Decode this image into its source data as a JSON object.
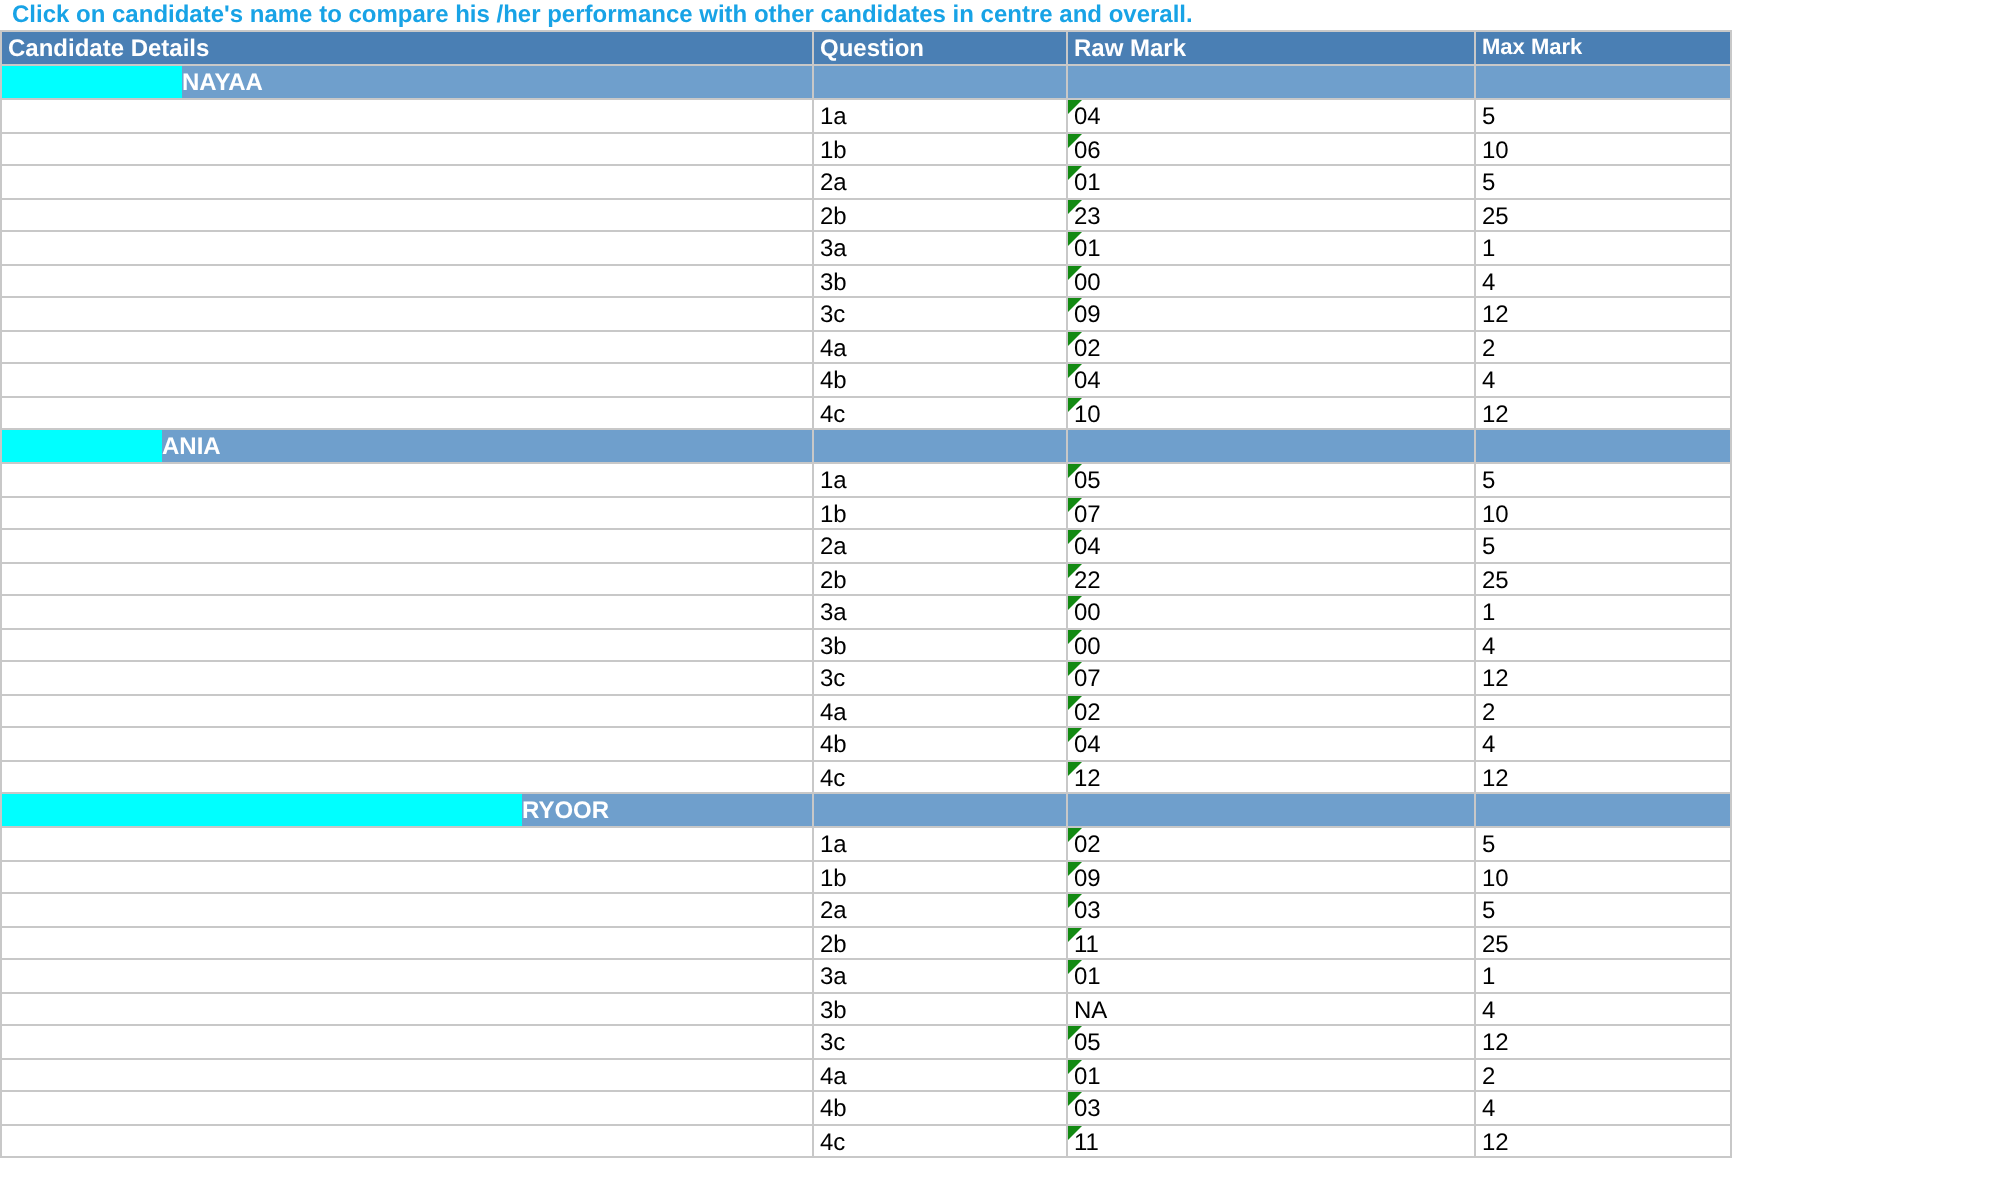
{
  "instruction": "Click on candidate's name to compare his /her performance with other candidates in centre and overall.",
  "table": {
    "columns": [
      "Candidate Details",
      "Question",
      "Raw Mark",
      "Max Mark"
    ],
    "groups": [
      {
        "candidate": "NAYAA",
        "rows": [
          {
            "question": "1a",
            "raw": "04",
            "flagged": true,
            "max": "5"
          },
          {
            "question": "1b",
            "raw": "06",
            "flagged": true,
            "max": "10"
          },
          {
            "question": "2a",
            "raw": "01",
            "flagged": true,
            "max": "5"
          },
          {
            "question": "2b",
            "raw": "23",
            "flagged": true,
            "max": "25"
          },
          {
            "question": "3a",
            "raw": "01",
            "flagged": true,
            "max": "1"
          },
          {
            "question": "3b",
            "raw": "00",
            "flagged": true,
            "max": "4"
          },
          {
            "question": "3c",
            "raw": "09",
            "flagged": true,
            "max": "12"
          },
          {
            "question": "4a",
            "raw": "02",
            "flagged": true,
            "max": "2"
          },
          {
            "question": "4b",
            "raw": "04",
            "flagged": true,
            "max": "4"
          },
          {
            "question": "4c",
            "raw": "10",
            "flagged": true,
            "max": "12"
          }
        ]
      },
      {
        "candidate": "ANIA",
        "rows": [
          {
            "question": "1a",
            "raw": "05",
            "flagged": true,
            "max": "5"
          },
          {
            "question": "1b",
            "raw": "07",
            "flagged": true,
            "max": "10"
          },
          {
            "question": "2a",
            "raw": "04",
            "flagged": true,
            "max": "5"
          },
          {
            "question": "2b",
            "raw": "22",
            "flagged": true,
            "max": "25"
          },
          {
            "question": "3a",
            "raw": "00",
            "flagged": true,
            "max": "1"
          },
          {
            "question": "3b",
            "raw": "00",
            "flagged": true,
            "max": "4"
          },
          {
            "question": "3c",
            "raw": "07",
            "flagged": true,
            "max": "12"
          },
          {
            "question": "4a",
            "raw": "02",
            "flagged": true,
            "max": "2"
          },
          {
            "question": "4b",
            "raw": "04",
            "flagged": true,
            "max": "4"
          },
          {
            "question": "4c",
            "raw": "12",
            "flagged": true,
            "max": "12"
          }
        ]
      },
      {
        "candidate": "RYOOR",
        "rows": [
          {
            "question": "1a",
            "raw": "02",
            "flagged": true,
            "max": "5"
          },
          {
            "question": "1b",
            "raw": "09",
            "flagged": true,
            "max": "10"
          },
          {
            "question": "2a",
            "raw": "03",
            "flagged": true,
            "max": "5"
          },
          {
            "question": "2b",
            "raw": "11",
            "flagged": true,
            "max": "25"
          },
          {
            "question": "3a",
            "raw": "01",
            "flagged": true,
            "max": "1"
          },
          {
            "question": "3b",
            "raw": "NA",
            "flagged": false,
            "max": "4"
          },
          {
            "question": "3c",
            "raw": "05",
            "flagged": true,
            "max": "12"
          },
          {
            "question": "4a",
            "raw": "01",
            "flagged": true,
            "max": "2"
          },
          {
            "question": "4b",
            "raw": "03",
            "flagged": true,
            "max": "4"
          },
          {
            "question": "4c",
            "raw": "11",
            "flagged": true,
            "max": "12"
          }
        ]
      }
    ]
  }
}
